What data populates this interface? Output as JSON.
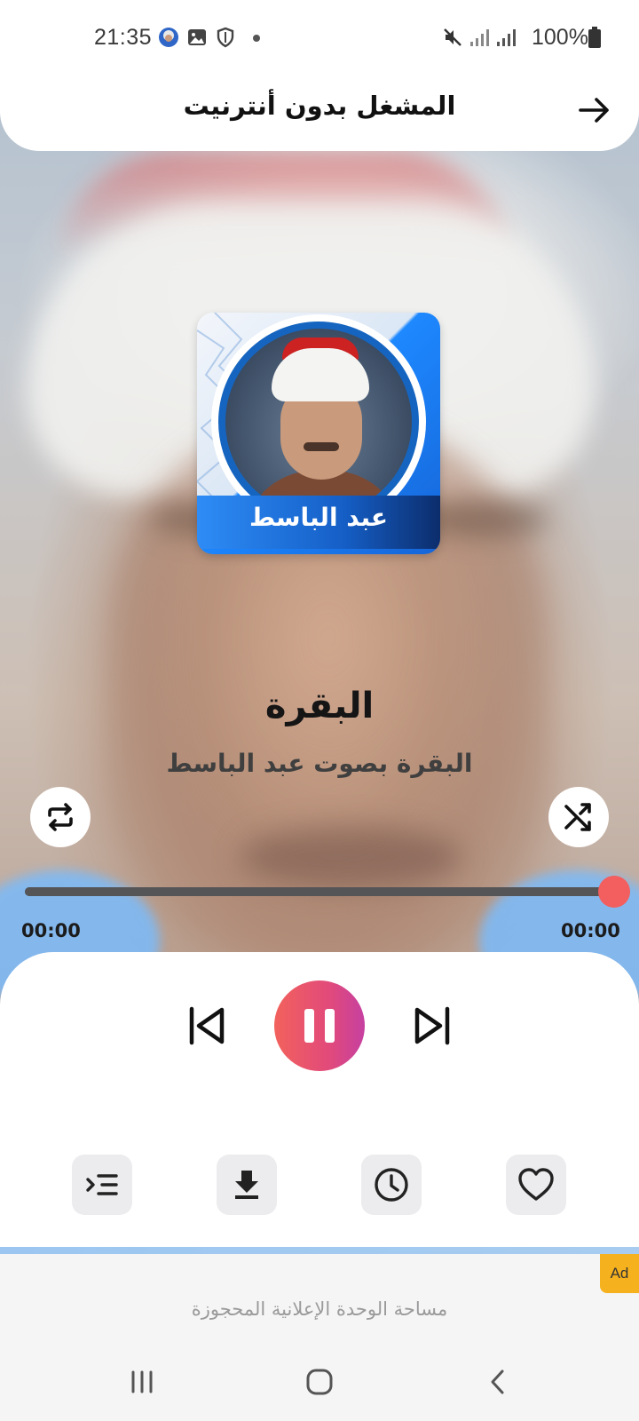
{
  "status_bar": {
    "time": "21:35",
    "battery": "100%",
    "icons": [
      "avatar-notification-icon",
      "gallery-icon",
      "shield-icon",
      "mute-icon",
      "signal-icon",
      "signal-icon",
      "battery-icon"
    ]
  },
  "header": {
    "title": "المشغل بدون أنترنيت",
    "back_icon": "arrow-right-icon"
  },
  "album": {
    "reciter_name": "عبد الباسط"
  },
  "track": {
    "title": "البقرة",
    "subtitle": "البقرة بصوت عبد الباسط"
  },
  "controls": {
    "repeat_icon": "repeat-icon",
    "shuffle_icon": "shuffle-icon",
    "previous_icon": "skip-previous-icon",
    "pause_icon": "pause-icon",
    "next_icon": "skip-next-icon"
  },
  "progress": {
    "position_fraction": 1.0,
    "elapsed": "00:00",
    "total": "00:00"
  },
  "tools": [
    {
      "name": "playlist",
      "icon": "playlist-icon"
    },
    {
      "name": "download",
      "icon": "download-icon"
    },
    {
      "name": "timer",
      "icon": "clock-icon"
    },
    {
      "name": "favorite",
      "icon": "heart-icon"
    }
  ],
  "ad": {
    "badge": "Ad",
    "placeholder": "مساحة الوحدة الإعلانية المحجوزة"
  },
  "colors": {
    "accent": "#f35e5e",
    "play_gradient_start": "#f2625c",
    "play_gradient_end": "#c640a0",
    "ad_badge": "#f6b21e"
  }
}
